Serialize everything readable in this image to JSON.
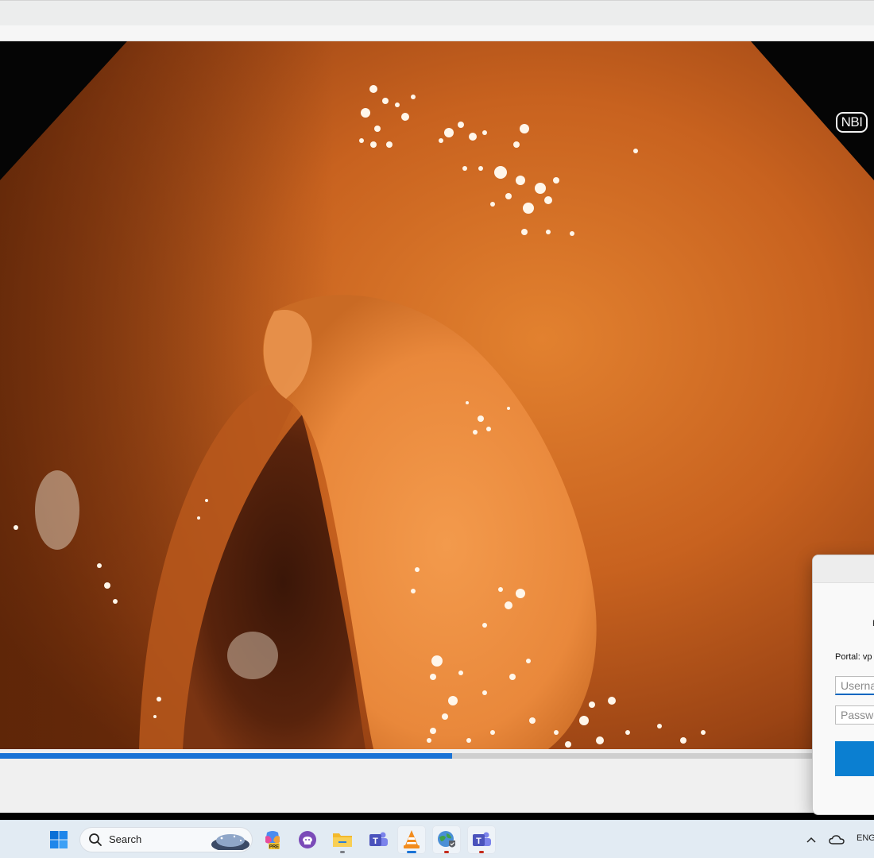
{
  "video": {
    "overlay_badge": "NBI",
    "seek_progress_percent": 55.7
  },
  "vpn_dialog": {
    "title_partial": "P",
    "portal_label": "Portal: vp",
    "username_placeholder": "Userna",
    "password_placeholder": "Passwo",
    "connect_color": "#0b7fd1"
  },
  "taskbar": {
    "search_placeholder": "Search",
    "apps": [
      {
        "name": "Windows Start",
        "icon": "windows-logo-icon"
      },
      {
        "name": "Copilot PRE",
        "icon": "copilot-icon",
        "badge": "PRE"
      },
      {
        "name": "GitHub Desktop",
        "icon": "github-icon"
      },
      {
        "name": "File Explorer",
        "icon": "folder-icon"
      },
      {
        "name": "Microsoft Teams",
        "icon": "teams-icon"
      },
      {
        "name": "VLC media player",
        "icon": "vlc-icon"
      },
      {
        "name": "VPN client",
        "icon": "globe-shield-icon"
      },
      {
        "name": "Microsoft Teams (work)",
        "icon": "teams-icon"
      }
    ],
    "tray_language": "ENG"
  },
  "colors": {
    "accent_blue": "#1a73d6",
    "taskbar_bg": "#e2ebf3",
    "tissue_orange": "#e07a2c"
  }
}
